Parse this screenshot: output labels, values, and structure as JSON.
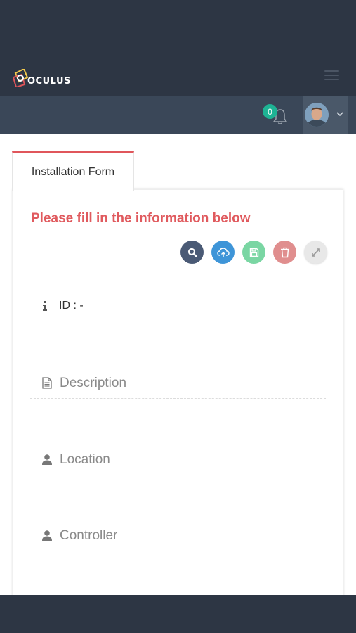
{
  "header": {
    "logo_text": "OCULUS",
    "notification_count": "0"
  },
  "tabs": [
    {
      "label": "Installation Form"
    }
  ],
  "form": {
    "title": "Please fill in the information below",
    "id_label": "ID : -",
    "fields": [
      {
        "icon": "document-icon",
        "placeholder": "Description",
        "value": ""
      },
      {
        "icon": "user-icon",
        "placeholder": "Location",
        "value": ""
      },
      {
        "icon": "user-icon",
        "placeholder": "Controller",
        "value": ""
      }
    ]
  },
  "actions": [
    {
      "icon": "search-icon",
      "color": "#4a5a75"
    },
    {
      "icon": "cloud-upload-icon",
      "color": "#3e95d8"
    },
    {
      "icon": "save-icon",
      "color": "#7ad6a3"
    },
    {
      "icon": "trash-icon",
      "color": "#e08e8e"
    },
    {
      "icon": "expand-icon",
      "color": "#e8e8e8"
    }
  ],
  "colors": {
    "topbar": "#2d3644",
    "subbar": "#3a4758",
    "accent": "#e05a5e",
    "badge": "#1eb394"
  }
}
